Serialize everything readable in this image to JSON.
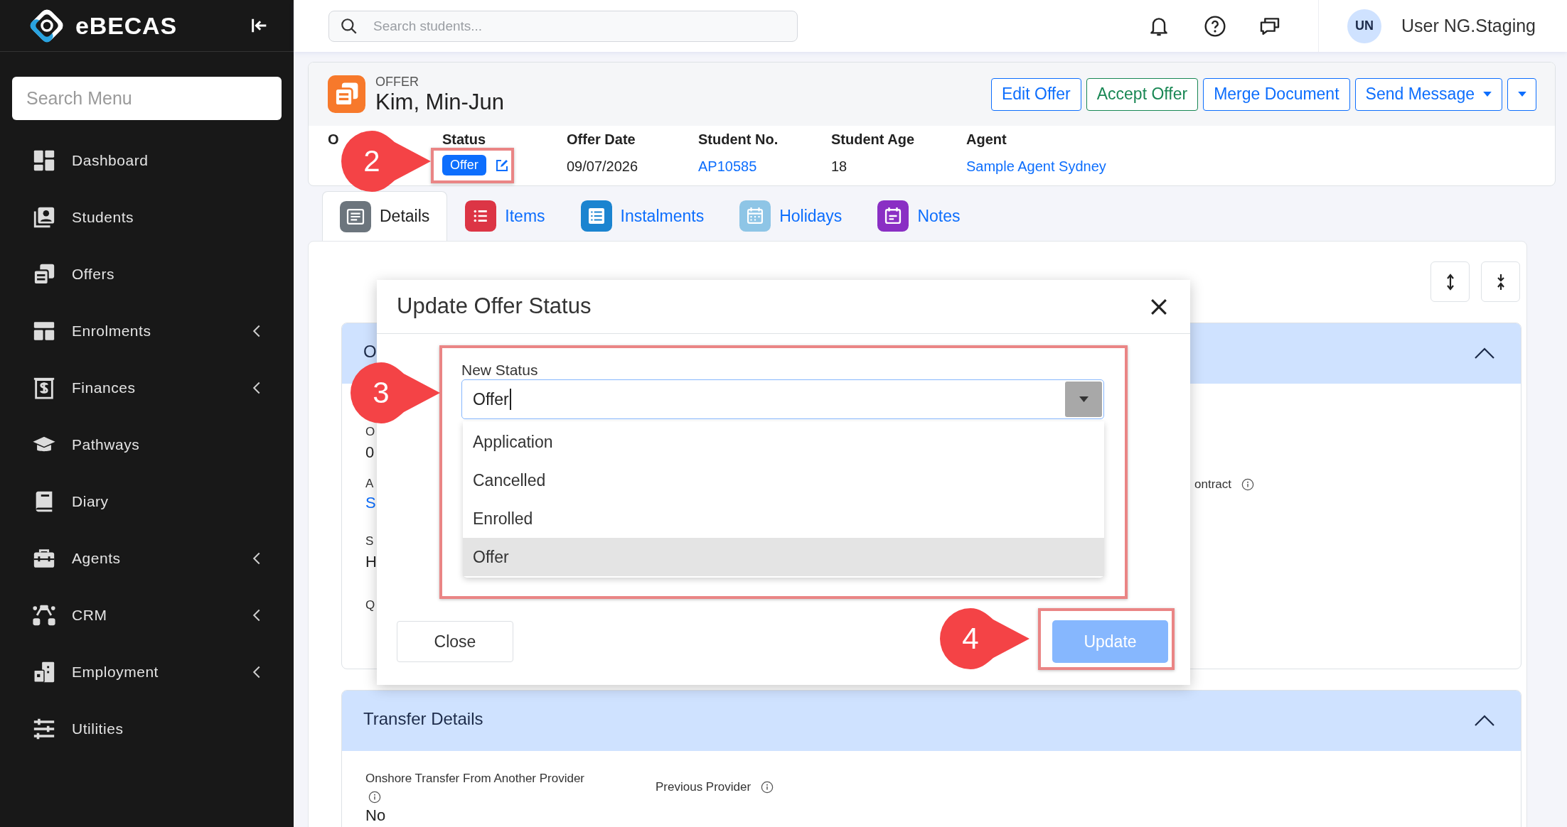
{
  "app": {
    "name": "eBECAS"
  },
  "sidebar": {
    "search_placeholder": "Search Menu",
    "items": [
      {
        "label": "Dashboard",
        "expandable": false
      },
      {
        "label": "Students",
        "expandable": false
      },
      {
        "label": "Offers",
        "expandable": false
      },
      {
        "label": "Enrolments",
        "expandable": true
      },
      {
        "label": "Finances",
        "expandable": true
      },
      {
        "label": "Pathways",
        "expandable": false
      },
      {
        "label": "Diary",
        "expandable": false
      },
      {
        "label": "Agents",
        "expandable": true
      },
      {
        "label": "CRM",
        "expandable": true
      },
      {
        "label": "Employment",
        "expandable": true
      },
      {
        "label": "Utilities",
        "expandable": false
      }
    ]
  },
  "top_bar": {
    "search_placeholder": "Search students...",
    "user_initials": "UN",
    "user_name": "User NG.Staging"
  },
  "record": {
    "type_label": "OFFER",
    "name": "Kim, Min-Jun",
    "actions": [
      {
        "label": "Edit Offer",
        "kind": "outline"
      },
      {
        "label": "Accept Offer",
        "kind": "success"
      },
      {
        "label": "Merge Document",
        "kind": "outline"
      },
      {
        "label": "Send Message",
        "kind": "dropdown"
      },
      {
        "kind": "caret"
      }
    ],
    "fields": [
      {
        "label": "O"
      },
      {
        "label": "Status",
        "value": "Offer",
        "kind": "badge"
      },
      {
        "label": "Offer Date",
        "value": "09/07/2026",
        "kind": "text"
      },
      {
        "label": "Student No.",
        "value": "AP10585",
        "kind": "link"
      },
      {
        "label": "Student Age",
        "value": "18",
        "kind": "text"
      },
      {
        "label": "Agent",
        "value": "Sample Agent Sydney",
        "kind": "link"
      }
    ]
  },
  "tabs": [
    {
      "label": "Details",
      "selected": true,
      "color": "#6c757d"
    },
    {
      "label": "Items",
      "selected": false,
      "color": "#dc3545"
    },
    {
      "label": "Instalments",
      "selected": false,
      "color": "#1b84d0"
    },
    {
      "label": "Holidays",
      "selected": false,
      "color": "#8ec5e6"
    },
    {
      "label": "Notes",
      "selected": false,
      "color": "#8a2fc4"
    }
  ],
  "sections": [
    {
      "title": "O",
      "expanded": true,
      "fragments": [
        {
          "text": "O",
          "kind": "label"
        },
        {
          "text": "0",
          "kind": "value"
        },
        {
          "text": "A",
          "kind": "label"
        },
        {
          "text": "S",
          "kind": "link"
        },
        {
          "text": "S",
          "kind": "label"
        },
        {
          "text": "H",
          "kind": "value"
        },
        {
          "text": "Q",
          "kind": "label"
        }
      ],
      "side_fragment": {
        "text": "ontract",
        "info": true
      }
    },
    {
      "title": "Transfer Details",
      "expanded": true,
      "fields": [
        {
          "label": "Onshore Transfer From Another Provider",
          "info": true,
          "value": "No"
        },
        {
          "label": "Previous Provider",
          "info": true
        }
      ]
    }
  ],
  "dialog": {
    "title": "Update Offer Status",
    "field_label": "New Status",
    "value": "Offer",
    "options": [
      {
        "label": "Application",
        "selected": false
      },
      {
        "label": "Cancelled",
        "selected": false
      },
      {
        "label": "Enrolled",
        "selected": false
      },
      {
        "label": "Offer",
        "selected": true
      }
    ],
    "buttons": [
      {
        "label": "Close",
        "kind": "secondary"
      },
      {
        "label": "Update",
        "kind": "primary"
      }
    ]
  },
  "annotations": [
    {
      "number": "2"
    },
    {
      "number": "3"
    },
    {
      "number": "4"
    }
  ]
}
